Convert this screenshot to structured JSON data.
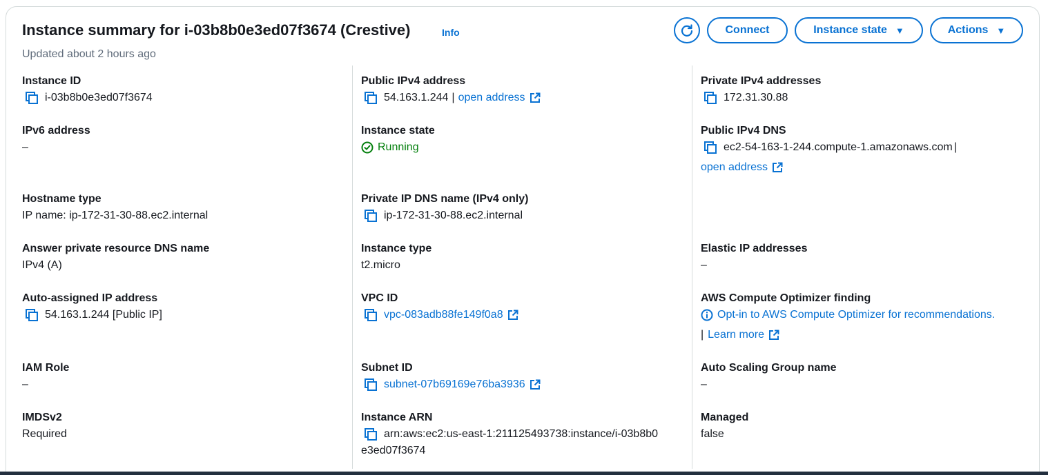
{
  "header": {
    "title": "Instance summary for i-03b8b0e3ed07f3674 (Crestive)",
    "info": "Info",
    "updated": "Updated about 2 hours ago",
    "buttons": {
      "connect": "Connect",
      "instance_state": "Instance state",
      "actions": "Actions"
    }
  },
  "col1": {
    "instance_id": {
      "label": "Instance ID",
      "value": "i-03b8b0e3ed07f3674"
    },
    "ipv6": {
      "label": "IPv6 address",
      "value": "–"
    },
    "hostname_type": {
      "label": "Hostname type",
      "value": "IP name: ip-172-31-30-88.ec2.internal"
    },
    "answer_dns": {
      "label": "Answer private resource DNS name",
      "value": "IPv4 (A)"
    },
    "auto_ip": {
      "label": "Auto-assigned IP address",
      "value": "54.163.1.244 [Public IP]"
    },
    "iam_role": {
      "label": "IAM Role",
      "value": "–"
    },
    "imdsv2": {
      "label": "IMDSv2",
      "value": "Required"
    }
  },
  "col2": {
    "public_ipv4": {
      "label": "Public IPv4 address",
      "value": "54.163.1.244",
      "sep": "|",
      "link": "open address"
    },
    "instance_state": {
      "label": "Instance state",
      "value": "Running"
    },
    "private_dns": {
      "label": "Private IP DNS name (IPv4 only)",
      "value": "ip-172-31-30-88.ec2.internal"
    },
    "instance_type": {
      "label": "Instance type",
      "value": "t2.micro"
    },
    "vpc_id": {
      "label": "VPC ID",
      "value": "vpc-083adb88fe149f0a8"
    },
    "subnet_id": {
      "label": "Subnet ID",
      "value": "subnet-07b69169e76ba3936"
    },
    "arn": {
      "label": "Instance ARN",
      "value_line1": "arn:aws:ec2:us-east-1:211125493738:instance/i-03b8b0",
      "value_line2": "e3ed07f3674"
    }
  },
  "col3": {
    "private_ipv4": {
      "label": "Private IPv4 addresses",
      "value": "172.31.30.88"
    },
    "public_dns": {
      "label": "Public IPv4 DNS",
      "value": "ec2-54-163-1-244.compute-1.amazonaws.com",
      "sep": "|",
      "link": "open address"
    },
    "elastic_ip": {
      "label": "Elastic IP addresses",
      "value": "–"
    },
    "optimizer": {
      "label": "AWS Compute Optimizer finding",
      "link": "Opt-in to AWS Compute Optimizer for recommendations.",
      "sep": "|",
      "learn_more": "Learn more"
    },
    "asg": {
      "label": "Auto Scaling Group name",
      "value": "–"
    },
    "managed": {
      "label": "Managed",
      "value": "false"
    }
  },
  "colors": {
    "link": "#0972d3",
    "running": "#037f0c",
    "text": "#16191f",
    "muted": "#5f6b7a"
  }
}
